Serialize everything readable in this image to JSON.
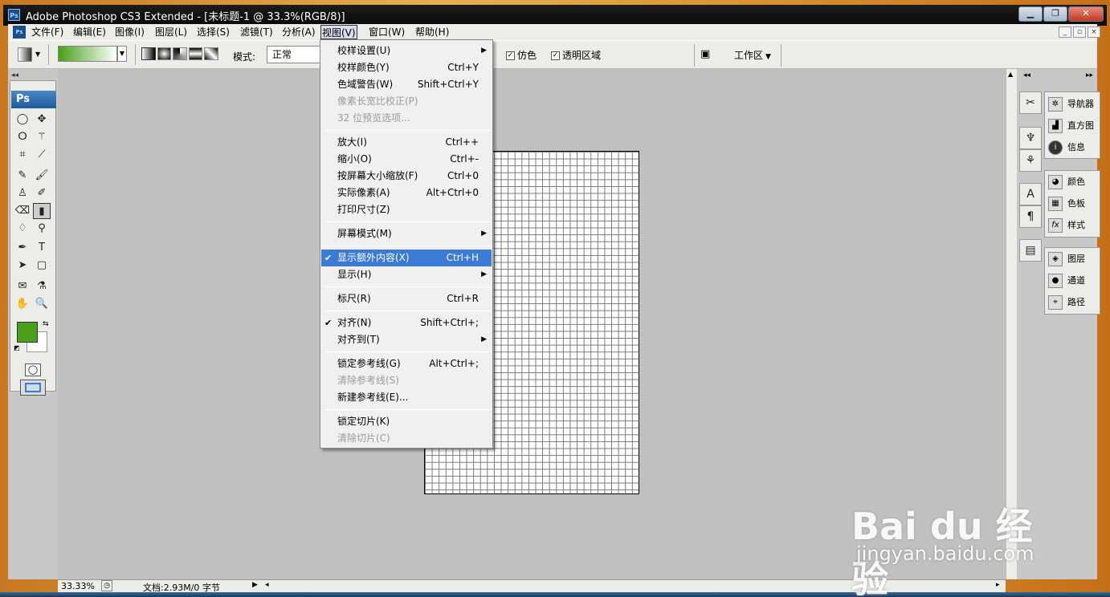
{
  "window": {
    "title": "Adobe Photoshop CS3 Extended - [未标题-1 @ 33.3%(RGB/8)]",
    "icon_text": "Ps",
    "controls": [
      "minimize-icon",
      "restore-icon",
      "close-icon"
    ]
  },
  "menubar": {
    "items": [
      "文件(F)",
      "编辑(E)",
      "图像(I)",
      "图层(L)",
      "选择(S)",
      "滤镜(T)",
      "分析(A)",
      "视图(V)",
      "窗口(W)",
      "帮助(H)"
    ],
    "active": "视图(V)"
  },
  "options": {
    "mode_label": "模式:",
    "mode_value": "正常",
    "dither_label": "仿色",
    "dither_checked": true,
    "transparency_label": "透明区域",
    "transparency_checked": true,
    "workspace_label": "工作区",
    "gradient_color": "#4aa01a"
  },
  "view_menu": {
    "items": [
      {
        "label": "校样设置(U)",
        "shortcut": "",
        "submenu": true,
        "disabled": false,
        "checked": false
      },
      {
        "label": "校样颜色(Y)",
        "shortcut": "Ctrl+Y",
        "submenu": false,
        "disabled": false,
        "checked": false
      },
      {
        "label": "色域警告(W)",
        "shortcut": "Shift+Ctrl+Y",
        "submenu": false,
        "disabled": false,
        "checked": false
      },
      {
        "label": "像素长宽比校正(P)",
        "shortcut": "",
        "submenu": false,
        "disabled": true,
        "checked": false
      },
      {
        "label": "32 位预览选项...",
        "shortcut": "",
        "submenu": false,
        "disabled": true,
        "checked": false
      },
      {
        "label": "放大(I)",
        "shortcut": "Ctrl++",
        "submenu": false,
        "disabled": false,
        "checked": false
      },
      {
        "label": "缩小(O)",
        "shortcut": "Ctrl+-",
        "submenu": false,
        "disabled": false,
        "checked": false
      },
      {
        "label": "按屏幕大小缩放(F)",
        "shortcut": "Ctrl+0",
        "submenu": false,
        "disabled": false,
        "checked": false
      },
      {
        "label": "实际像素(A)",
        "shortcut": "Alt+Ctrl+0",
        "submenu": false,
        "disabled": false,
        "checked": false
      },
      {
        "label": "打印尺寸(Z)",
        "shortcut": "",
        "submenu": false,
        "disabled": false,
        "checked": false
      },
      {
        "label": "屏幕模式(M)",
        "shortcut": "",
        "submenu": true,
        "disabled": false,
        "checked": false
      },
      {
        "label": "显示额外内容(X)",
        "shortcut": "Ctrl+H",
        "submenu": false,
        "disabled": false,
        "checked": true,
        "highlighted": true
      },
      {
        "label": "显示(H)",
        "shortcut": "",
        "submenu": true,
        "disabled": false,
        "checked": false
      },
      {
        "label": "标尺(R)",
        "shortcut": "Ctrl+R",
        "submenu": false,
        "disabled": false,
        "checked": false
      },
      {
        "label": "对齐(N)",
        "shortcut": "Shift+Ctrl+;",
        "submenu": false,
        "disabled": false,
        "checked": true
      },
      {
        "label": "对齐到(T)",
        "shortcut": "",
        "submenu": true,
        "disabled": false,
        "checked": false
      },
      {
        "label": "锁定参考线(G)",
        "shortcut": "Alt+Ctrl+;",
        "submenu": false,
        "disabled": false,
        "checked": false
      },
      {
        "label": "清除参考线(S)",
        "shortcut": "",
        "submenu": false,
        "disabled": true,
        "checked": false
      },
      {
        "label": "新建参考线(E)...",
        "shortcut": "",
        "submenu": false,
        "disabled": false,
        "checked": false
      },
      {
        "label": "锁定切片(K)",
        "shortcut": "",
        "submenu": false,
        "disabled": false,
        "checked": false
      },
      {
        "label": "清除切片(C)",
        "shortcut": "",
        "submenu": false,
        "disabled": true,
        "checked": false
      }
    ]
  },
  "toolbox": {
    "brand": "Ps",
    "foreground_color": "#4aa01a",
    "background_color": "#ffffff"
  },
  "panels": {
    "group1": [
      "导航器",
      "直方图",
      "信息"
    ],
    "group2": [
      "颜色",
      "色板",
      "样式"
    ],
    "group3": [
      "图层",
      "通道",
      "路径"
    ]
  },
  "status": {
    "zoom": "33.33%",
    "doc_info": "文档:2.93M/0 字节"
  },
  "watermark": {
    "brand": "Bai du 经验",
    "url": "jingyan.baidu.com"
  }
}
